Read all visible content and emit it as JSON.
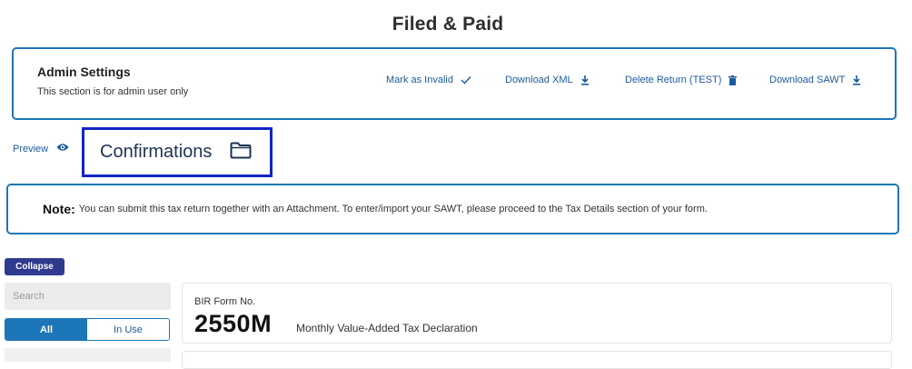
{
  "page": {
    "title": "Filed & Paid"
  },
  "admin": {
    "title": "Admin Settings",
    "subtitle": "This section is for admin user only",
    "actions": [
      {
        "label": "Mark as Invalid",
        "icon": "check-icon"
      },
      {
        "label": "Download XML",
        "icon": "download-icon"
      },
      {
        "label": "Delete Return (TEST)",
        "icon": "trash-icon"
      },
      {
        "label": "Download SAWT",
        "icon": "download-icon"
      }
    ]
  },
  "preview": {
    "label": "Preview",
    "icon": "eye-icon"
  },
  "confirmations": {
    "label": "Confirmations",
    "icon": "folder-icon",
    "highlight_color": "#1226c4"
  },
  "note": {
    "label": "Note:",
    "text": "You can submit this tax return together with an Attachment. To enter/import your SAWT, please proceed to the Tax Details section of your form."
  },
  "sidebar": {
    "collapse_label": "Collapse",
    "search_placeholder": "Search",
    "filters": [
      "All",
      "In Use"
    ],
    "active_filter": "All"
  },
  "form": {
    "label": "BIR Form No.",
    "code": "2550M",
    "description": "Monthly Value-Added Tax Declaration"
  },
  "colors": {
    "accent": "#1c76b8",
    "link": "#1c5a9e",
    "collapse_button": "#2f3a8f"
  }
}
